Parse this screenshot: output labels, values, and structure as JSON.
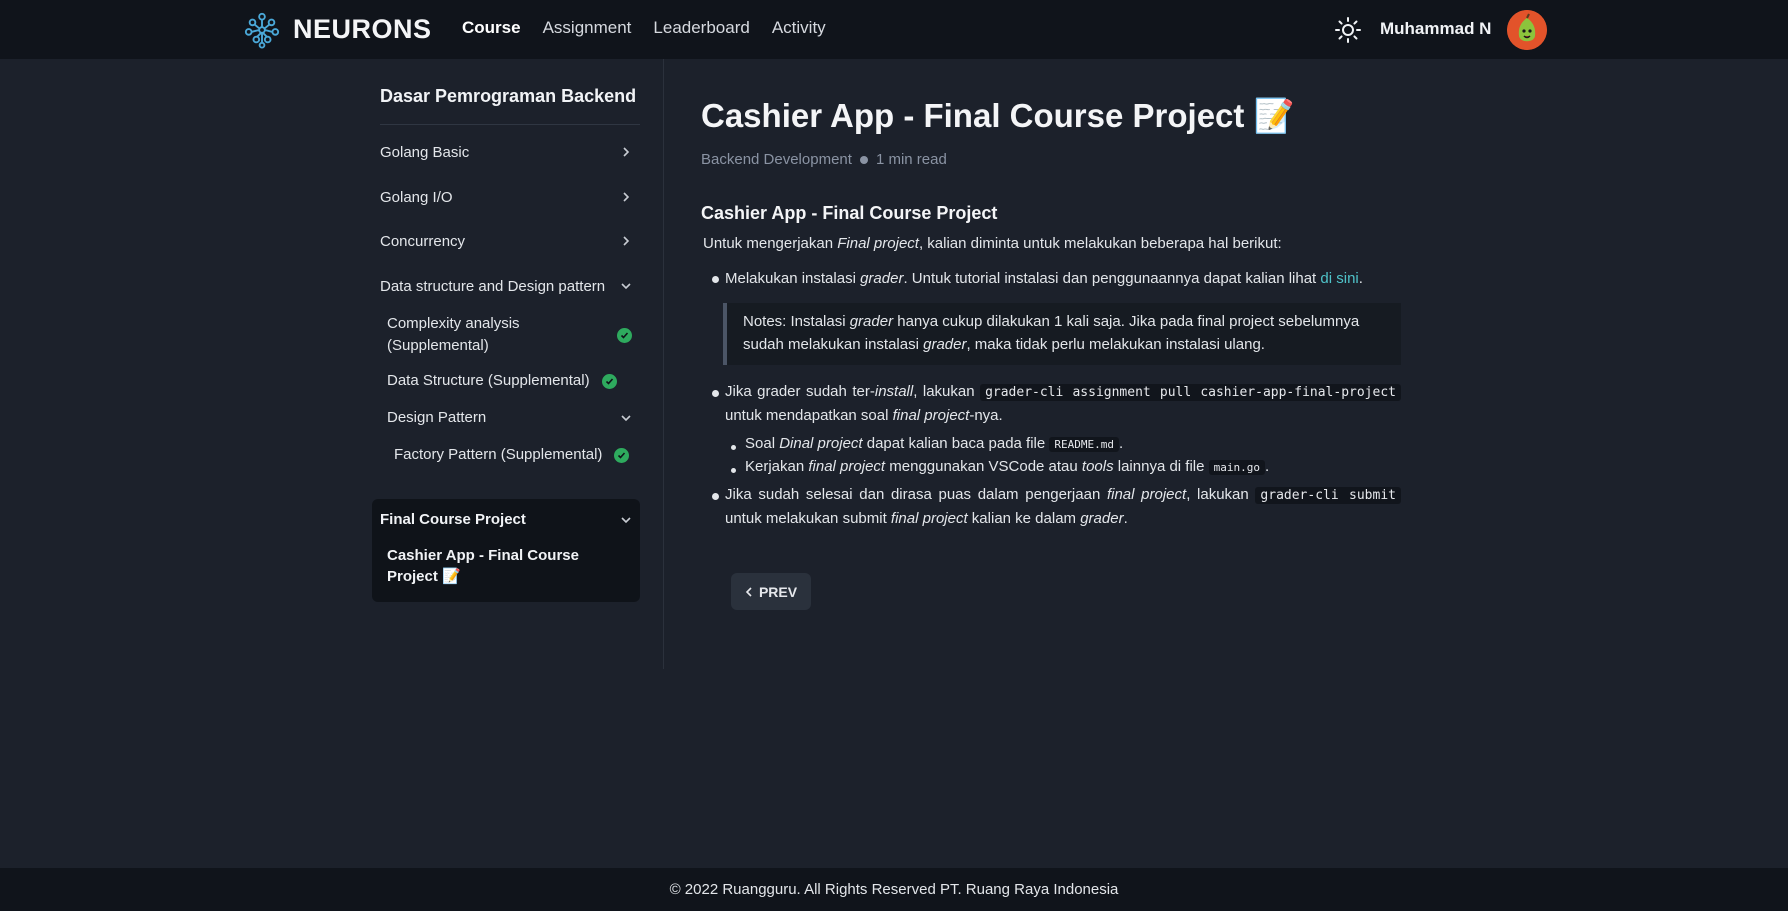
{
  "header": {
    "brand": "NEURONS",
    "nav": [
      "Course",
      "Assignment",
      "Leaderboard",
      "Activity"
    ],
    "active_nav": "Course",
    "user_name": "Muhammad N"
  },
  "sidebar": {
    "course_title": "Dasar Pemrograman Backend",
    "items": [
      {
        "label": "Golang Basic"
      },
      {
        "label": "Golang I/O"
      },
      {
        "label": "Concurrency"
      },
      {
        "label": "Data structure and Design pattern"
      }
    ],
    "sub_items": [
      {
        "label": "Complexity analysis (Supplemental)",
        "completed": true
      },
      {
        "label": "Data Structure (Supplemental)",
        "completed": true
      },
      {
        "label": "Design Pattern"
      },
      {
        "label": "Factory Pattern (Supplemental)",
        "completed": true
      }
    ],
    "final_section": {
      "label": "Final Course Project",
      "item": "Cashier App - Final Course Project 📝"
    }
  },
  "main": {
    "title": "Cashier App - Final Course Project 📝",
    "category": "Backend Development",
    "read_time": "1 min read",
    "section_title": "Cashier App - Final Course Project",
    "intro_pre": "Untuk mengerjakan ",
    "intro_em": "Final project",
    "intro_post": ", kalian diminta untuk melakukan beberapa hal berikut:",
    "b1_pre": "Melakukan instalasi ",
    "b1_em": "grader",
    "b1_post": ". Untuk tutorial instalasi dan penggunaannya dapat kalian lihat ",
    "b1_link": "di sini",
    "b1_end": ".",
    "note_pre": "Notes: Instalasi ",
    "note_em1": "grader",
    "note_mid": " hanya cukup dilakukan 1 kali saja. Jika pada final project sebelumnya sudah melakukan instalasi ",
    "note_em2": "grader",
    "note_post": ", maka tidak perlu melakukan instalasi ulang.",
    "b2_pre": "Jika grader sudah ter-",
    "b2_em": "install",
    "b2_mid": ", lakukan ",
    "b2_code": "grader-cli assignment pull cashier-app-final-project",
    "b2_post1": " untuk mendapatkan soal ",
    "b2_em2": "final project",
    "b2_post2": "-nya.",
    "s1_pre": "Soal ",
    "s1_em": "Dinal project",
    "s1_mid": " dapat kalian baca pada file ",
    "s1_code": "README.md",
    "s1_end": ".",
    "s2_pre": "Kerjakan ",
    "s2_em": "final project",
    "s2_mid": " menggunakan VSCode atau ",
    "s2_em2": "tools",
    "s2_mid2": " lainnya di file ",
    "s2_code": "main.go",
    "s2_end": ".",
    "b3_pre": "Jika sudah selesai dan dirasa puas dalam pengerjaan ",
    "b3_em": "final project",
    "b3_mid": ", lakukan ",
    "b3_code": "grader-cli submit",
    "b3_post1": " untuk melakukan submit ",
    "b3_em2": "final project",
    "b3_post2": " kalian ke dalam ",
    "b3_em3": "grader",
    "b3_end": ".",
    "prev_label": "PREV"
  },
  "footer": {
    "text": "© 2022 Ruangguru. All Rights Reserved PT. Ruang Raya Indonesia"
  },
  "colors": {
    "background": "#1c212b",
    "topbar": "#10141b",
    "link": "#4fc3c9",
    "check": "#2eaa5e"
  }
}
